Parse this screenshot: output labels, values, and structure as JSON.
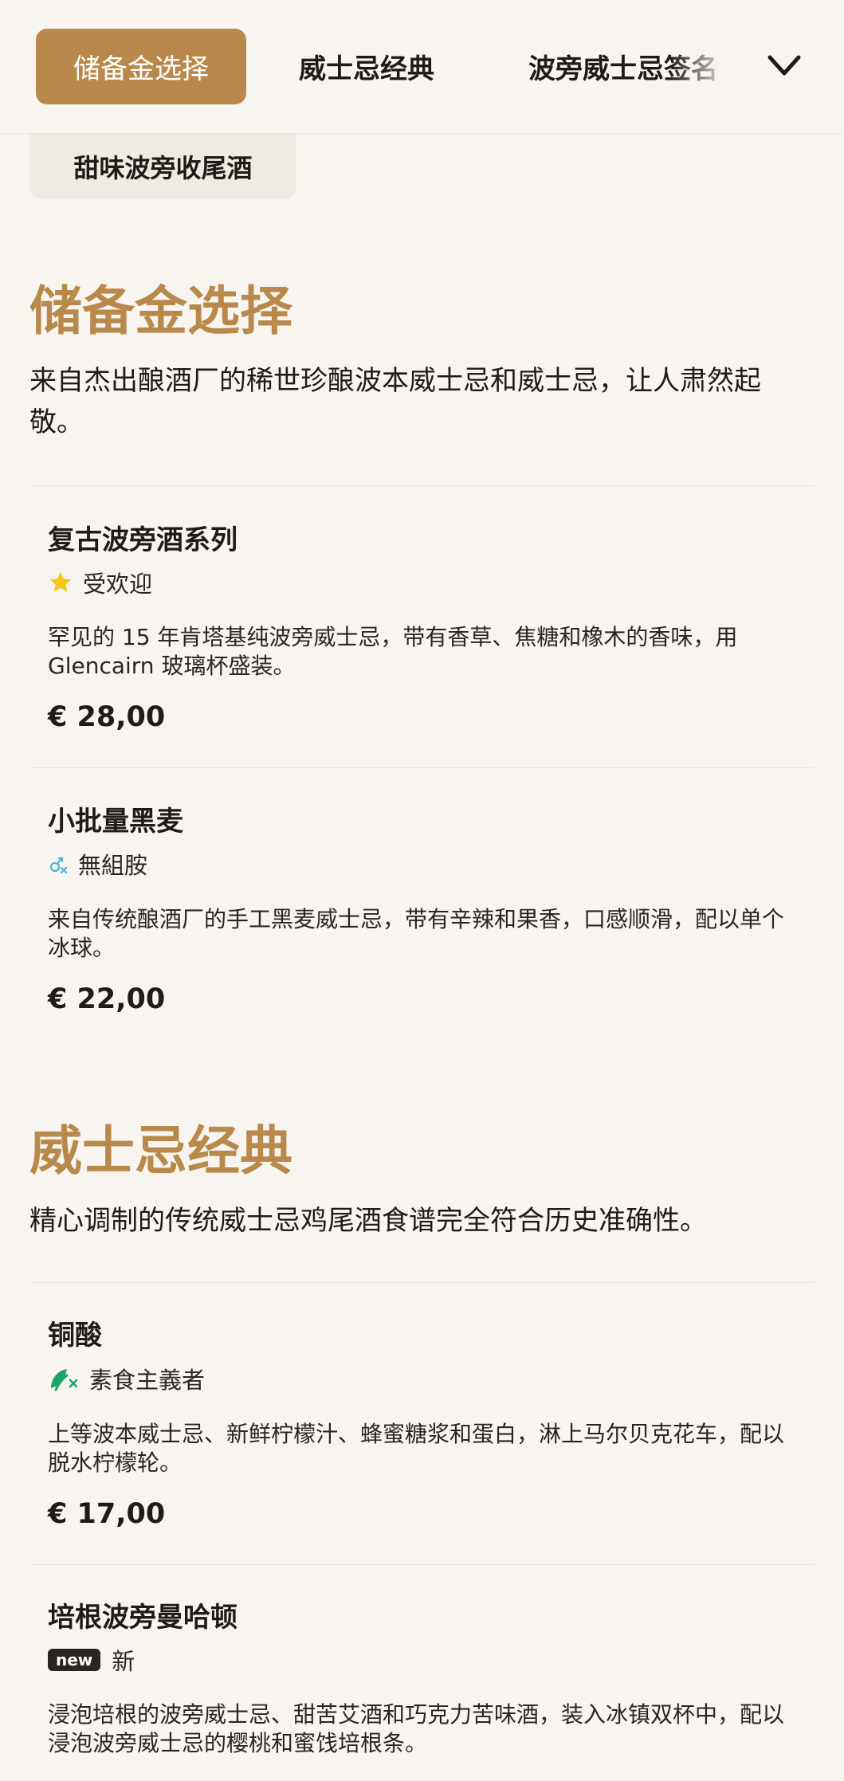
{
  "nav": {
    "active_tab": "储备金选择",
    "tab2": "威士忌经典",
    "tab3": "波旁威士忌签名"
  },
  "chip": {
    "label": "甜味波旁收尾酒"
  },
  "sections": [
    {
      "title": "储备金选择",
      "description": "来自杰出酿酒厂的稀世珍酿波本威士忌和威士忌，让人肃然起敬。",
      "items": [
        {
          "name": "复古波旁酒系列",
          "badge": "受欢迎",
          "badge_icon": "star-icon",
          "description": "罕见的 15 年肯塔基纯波旁威士忌，带有香草、焦糖和橡木的香味，用 Glencairn 玻璃杯盛装。",
          "price": "€ 28,00"
        },
        {
          "name": "小批量黑麦",
          "badge": "無組胺",
          "badge_icon": "histamine-free-icon",
          "description": "来自传统酿酒厂的手工黑麦威士忌，带有辛辣和果香，口感顺滑，配以单个冰球。",
          "price": "€ 22,00"
        }
      ]
    },
    {
      "title": "威士忌经典",
      "description": "精心调制的传统威士忌鸡尾酒食谱完全符合历史准确性。",
      "items": [
        {
          "name": "铜酸",
          "badge": "素食主義者",
          "badge_icon": "vegan-icon",
          "description": "上等波本威士忌、新鲜柠檬汁、蜂蜜糖浆和蛋白，淋上马尔贝克花车，配以脱水柠檬轮。",
          "price": "€ 17,00"
        },
        {
          "name": "培根波旁曼哈顿",
          "badge": "新",
          "badge_pill": "new",
          "badge_icon": "new-badge-icon",
          "description": "浸泡培根的波旁威士忌、甜苦艾酒和巧克力苦味酒，装入冰镇双杯中，配以浸泡波旁威士忌的樱桃和蜜饯培根条。"
        }
      ]
    }
  ],
  "colors": {
    "accent": "#b8894a",
    "background": "#f8f5f0",
    "chip_bg": "#efebe4",
    "star": "#f5c518",
    "histamine": "#4fb3d9",
    "vegan": "#1aa36b"
  }
}
